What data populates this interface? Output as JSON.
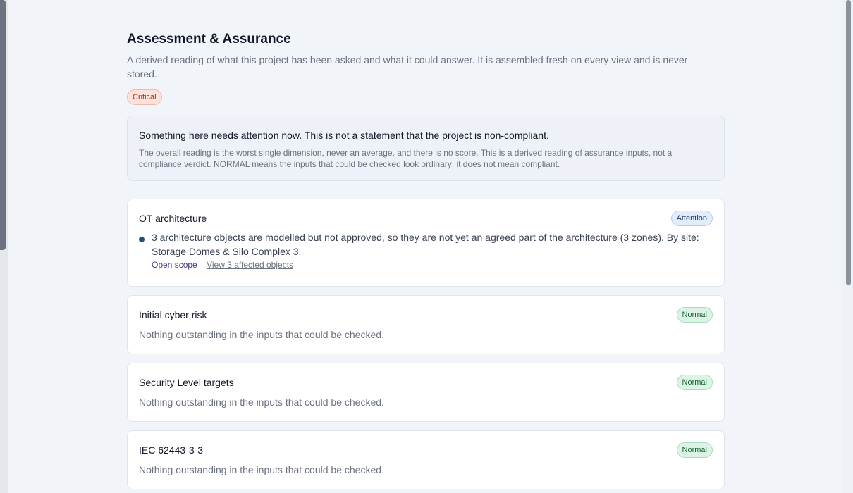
{
  "header": {
    "title": "Assessment & Assurance",
    "subtitle": "A derived reading of what this project has been asked and what it could answer. It is assembled fresh on every view and is never stored.",
    "overall_status": "Critical"
  },
  "summary": {
    "main": "Something here needs attention now. This is not a statement that the project is non-compliant.",
    "note": "The overall reading is the worst single dimension, never an average, and there is no score. This is a derived reading of assurance inputs, not a compliance verdict. NORMAL means the inputs that could be checked look ordinary; it does not mean compliant."
  },
  "dimensions": [
    {
      "title": "OT architecture",
      "status": "Attention",
      "finding": "3 architecture objects are modelled but not approved, so they are not yet an agreed part of the architecture (3 zones). By site: Storage Domes & Silo Complex 3.",
      "open_scope_label": "Open scope",
      "view_objects_label": "View 3 affected objects"
    },
    {
      "title": "Initial cyber risk",
      "status": "Normal",
      "text": "Nothing outstanding in the inputs that could be checked."
    },
    {
      "title": "Security Level targets",
      "status": "Normal",
      "text": "Nothing outstanding in the inputs that could be checked."
    },
    {
      "title": "IEC 62443-3-3",
      "status": "Normal",
      "text": "Nothing outstanding in the inputs that could be checked."
    }
  ],
  "colors": {
    "critical": "#9a3412",
    "attention": "#1e3a6e",
    "normal": "#166534",
    "link": "#4c2e91"
  }
}
